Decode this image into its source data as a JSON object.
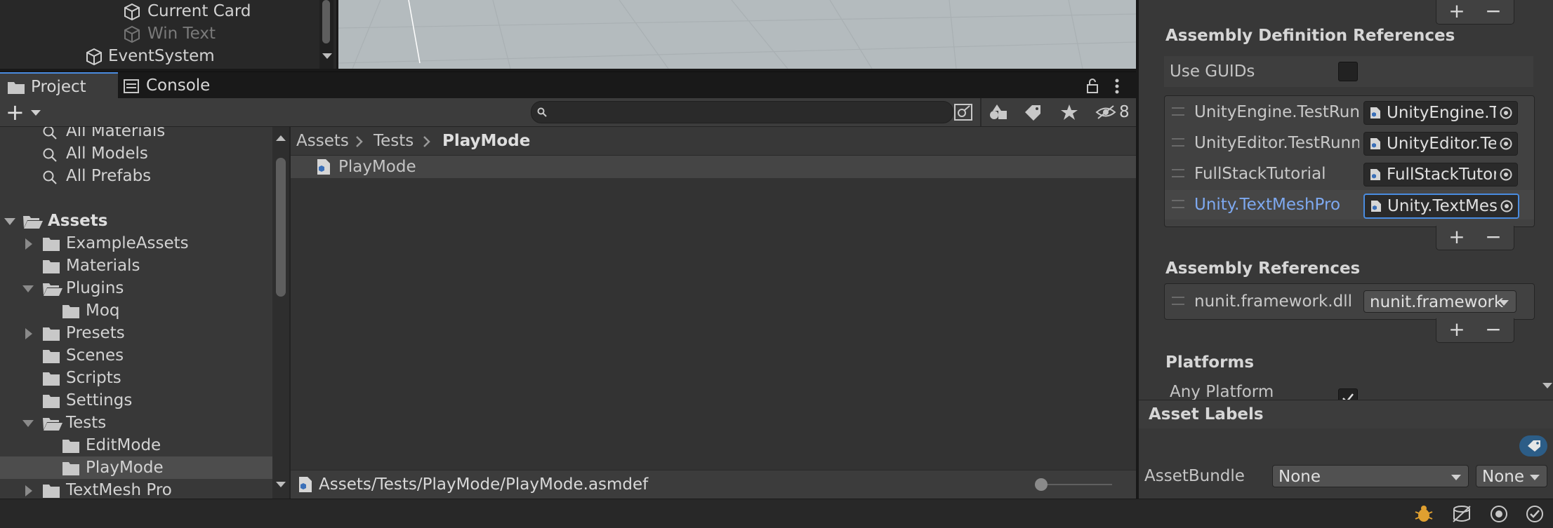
{
  "hierarchy": {
    "items": [
      {
        "label": "Current Card",
        "dim": false
      },
      {
        "label": "Win Text",
        "dim": true
      },
      {
        "label": "EventSystem",
        "dim": false
      }
    ]
  },
  "tabs": {
    "project": "Project",
    "console": "Console"
  },
  "toolbar": {
    "add_label": "+",
    "hidden_count": "8"
  },
  "tree": {
    "favorites": [
      "All Materials",
      "All Models",
      "All Prefabs"
    ],
    "root": "Assets",
    "folders": [
      {
        "label": "ExampleAssets",
        "indent": 1,
        "expand": "collapsed"
      },
      {
        "label": "Materials",
        "indent": 1,
        "expand": "none"
      },
      {
        "label": "Plugins",
        "indent": 1,
        "expand": "expanded"
      },
      {
        "label": "Moq",
        "indent": 2,
        "expand": "none"
      },
      {
        "label": "Presets",
        "indent": 1,
        "expand": "collapsed"
      },
      {
        "label": "Scenes",
        "indent": 1,
        "expand": "none"
      },
      {
        "label": "Scripts",
        "indent": 1,
        "expand": "none"
      },
      {
        "label": "Settings",
        "indent": 1,
        "expand": "none"
      },
      {
        "label": "Tests",
        "indent": 1,
        "expand": "expanded"
      },
      {
        "label": "EditMode",
        "indent": 2,
        "expand": "none"
      },
      {
        "label": "PlayMode",
        "indent": 2,
        "expand": "none",
        "selected": true
      },
      {
        "label": "TextMesh Pro",
        "indent": 1,
        "expand": "collapsed"
      }
    ]
  },
  "breadcrumb": {
    "parts": [
      "Assets",
      "Tests",
      "PlayMode"
    ]
  },
  "main": {
    "file": "PlayMode"
  },
  "statusbar": {
    "path": "Assets/Tests/PlayMode/PlayMode.asmdef"
  },
  "inspector": {
    "asm_def_refs_title": "Assembly Definition References",
    "use_guids_label": "Use GUIDs",
    "refs": [
      {
        "label": "UnityEngine.TestRunner",
        "value": "UnityEngine.TestRunner"
      },
      {
        "label": "UnityEditor.TestRunner",
        "value": "UnityEditor.TestRunner"
      },
      {
        "label": "FullStackTutorial",
        "value": "FullStackTutorial"
      },
      {
        "label": "Unity.TextMeshPro",
        "value": "Unity.TextMeshPro"
      }
    ],
    "asm_refs_title": "Assembly References",
    "asm_ref": {
      "label": "nunit.framework.dll",
      "value": "nunit.framework"
    },
    "platforms_title": "Platforms",
    "any_platform": "Any Platform",
    "plus": "+",
    "minus": "−"
  },
  "asset_labels": {
    "title": "Asset Labels",
    "assetbundle_label": "AssetBundle",
    "bundle_value": "None",
    "variant_value": "None"
  },
  "colors": {
    "accent": "#4a8ce0",
    "selected_row": "#2c5d87",
    "link_text": "#7ea9f0"
  }
}
